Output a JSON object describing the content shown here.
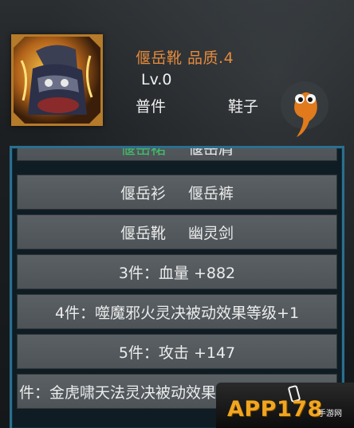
{
  "item": {
    "name_quality": "偃岳靴 品质.4",
    "level": "Lv.0",
    "rarity": "普件",
    "slot": "鞋子"
  },
  "set_panel": {
    "top_partial": {
      "a": "偃岳裙",
      "b": "偃岳肩"
    },
    "pieces": [
      {
        "a": "偃岳衫",
        "b": "偃岳裤"
      },
      {
        "a": "偃岳靴",
        "b": "幽灵剑"
      }
    ],
    "bonuses": [
      "3件：血量 +882",
      "4件：噬魔邪火灵决被动效果等级+1",
      "5件：攻击 +147",
      "件：金虎啸天法灵决被动效果等级+1"
    ]
  },
  "logo": {
    "brand": "APP178",
    "sub": "手游网"
  },
  "colors": {
    "name": "#e58b3d",
    "panel_border": "#2b6f8f",
    "active_piece": "#42c26a",
    "row_bg": "#555b5f"
  }
}
